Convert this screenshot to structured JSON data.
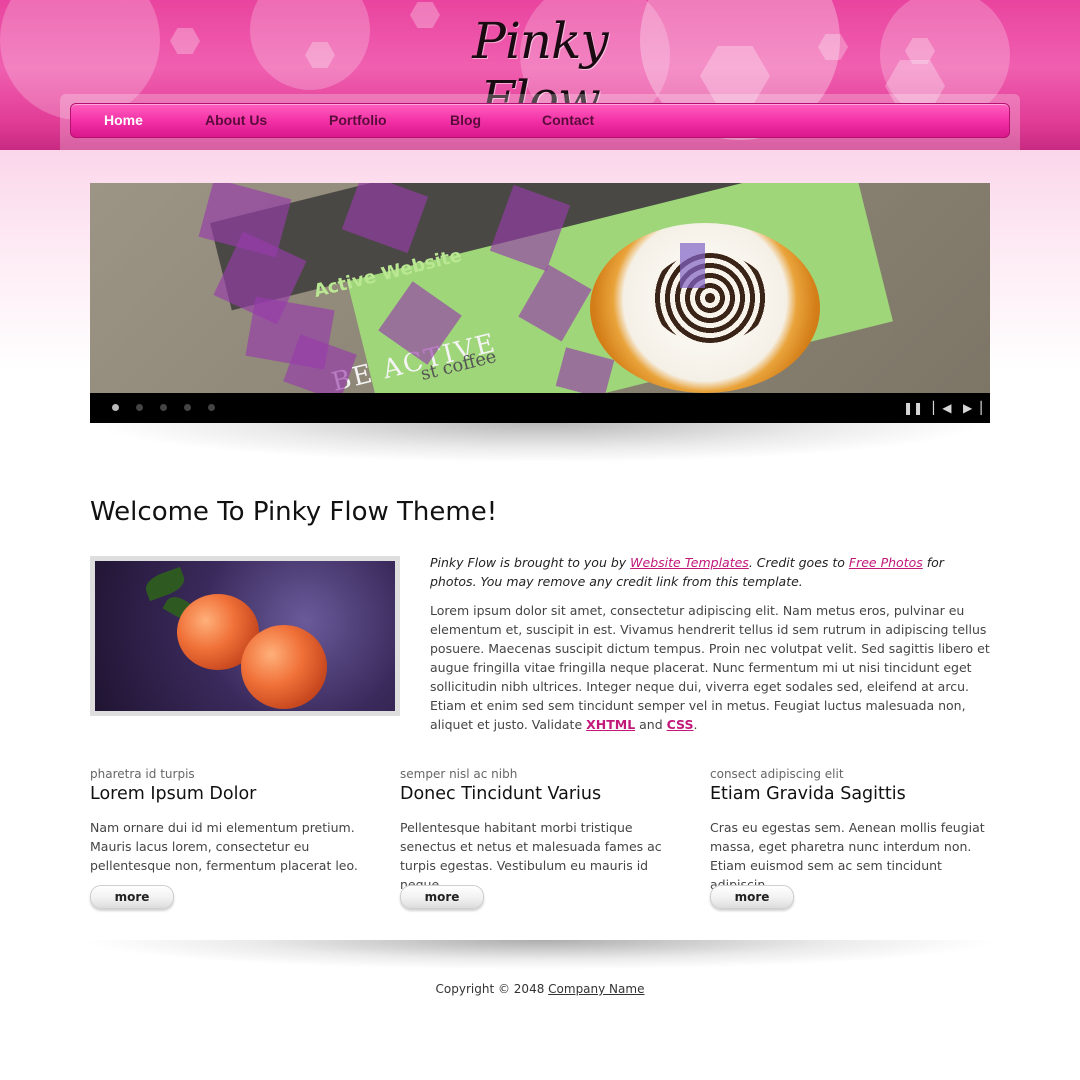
{
  "site": {
    "logo_text": "Pinky Flow"
  },
  "nav": {
    "items": [
      {
        "label": "Home",
        "active": true
      },
      {
        "label": "About Us",
        "active": false
      },
      {
        "label": "Portfolio",
        "active": false
      },
      {
        "label": "Blog",
        "active": false
      },
      {
        "label": "Contact",
        "active": false
      }
    ]
  },
  "slider": {
    "slide_text_1": "Active Website",
    "slide_text_2": "BE ACTIVE",
    "slide_text_3": "st coffee",
    "dots_count": 5,
    "active_dot": 0,
    "controls": [
      "pause-icon",
      "previous-icon",
      "next-icon"
    ]
  },
  "welcome": {
    "heading": "Welcome To Pinky Flow Theme!",
    "intro_prefix": "Pinky Flow is brought to you by ",
    "intro_link1": "Website Templates",
    "intro_mid": ". Credit goes to ",
    "intro_link2": "Free Photos",
    "intro_suffix": " for photos. You may remove any credit link from this template.",
    "body": "Lorem ipsum dolor sit amet, consectetur adipiscing elit. Nam metus eros, pulvinar eu elementum et, suscipit in est. Vivamus hendrerit tellus id sem rutrum in adipiscing tellus posuere. Maecenas suscipit dictum tempus. Proin nec volutpat velit. Sed sagittis libero et augue fringilla vitae fringilla neque placerat. Nunc fermentum mi ut nisi tincidunt eget sollicitudin nibh ultrices. Integer neque dui, viverra eget sodales sed, eleifend at arcu. Etiam et enim sed sem tincidunt semper vel in metus. Feugiat luctus malesuada non, aliquet et justo. Validate ",
    "validate_xhtml": "XHTML",
    "validate_and": " and ",
    "validate_css": "CSS",
    "validate_end": "."
  },
  "columns": [
    {
      "subtitle": "pharetra id turpis",
      "title": "Lorem Ipsum Dolor",
      "text": "Nam ornare dui id mi elementum pretium. Mauris lacus lorem, consectetur eu pellentesque non, fermentum placerat leo.",
      "button": "more"
    },
    {
      "subtitle": "semper nisl ac nibh",
      "title": "Donec Tincidunt Varius",
      "text": "Pellentesque habitant morbi tristique senectus et netus et malesuada fames ac turpis egestas. Vestibulum eu mauris id neque.",
      "button": "more"
    },
    {
      "subtitle": "consect adipiscing elit",
      "title": "Etiam Gravida Sagittis",
      "text": "Cras eu egestas sem. Aenean mollis feugiat massa, eget pharetra nunc interdum non. Etiam euismod sem ac sem tincidunt adipiscin.",
      "button": "more"
    }
  ],
  "footer": {
    "copyright": "Copyright © 2048 ",
    "company_link": "Company Name"
  }
}
